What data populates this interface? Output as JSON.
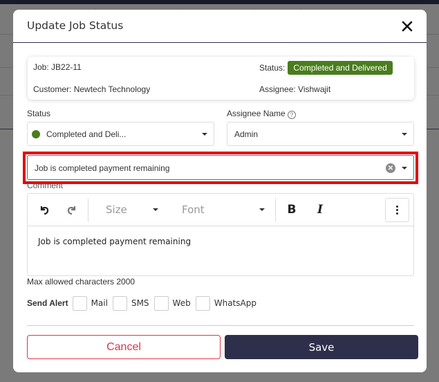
{
  "modal": {
    "title": "Update Job Status",
    "close_icon": "close-icon"
  },
  "summary": {
    "job_label": "Job:",
    "job_value": "JB22-11",
    "customer_label": "Customer:",
    "customer_value": "Newtech Technology",
    "status_label": "Status:",
    "status_value": "Completed and Delivered",
    "status_color": "#4a7d1e",
    "assignee_label": "Assignee:",
    "assignee_value": "Vishwajit"
  },
  "form": {
    "status_label": "Status",
    "status_selected": "Completed and Deli...",
    "status_dot_color": "#4a7d1e",
    "assignee_label": "Assignee Name",
    "assignee_help": "?",
    "assignee_selected": "Admin",
    "reason_selected": "Job is completed payment remaining",
    "comment_label": "Comment"
  },
  "editor": {
    "toolbar": {
      "undo_icon": "undo-icon",
      "redo_icon": "redo-icon",
      "size_placeholder": "Size",
      "font_placeholder": "Font",
      "bold_label": "B",
      "italic_label": "I",
      "more_icon": "more-vertical-icon"
    },
    "content": "Job is completed payment remaining",
    "hint": "Max allowed characters 2000"
  },
  "send_alert": {
    "label": "Send Alert",
    "options": [
      {
        "label": "Mail",
        "checked": false
      },
      {
        "label": "SMS",
        "checked": false
      },
      {
        "label": "Web",
        "checked": false
      },
      {
        "label": "WhatsApp",
        "checked": false
      }
    ]
  },
  "actions": {
    "cancel_label": "Cancel",
    "save_label": "Save"
  },
  "colors": {
    "highlight": "#e8000c",
    "cancel": "#dc3545",
    "save_bg": "#2e2f4b"
  }
}
